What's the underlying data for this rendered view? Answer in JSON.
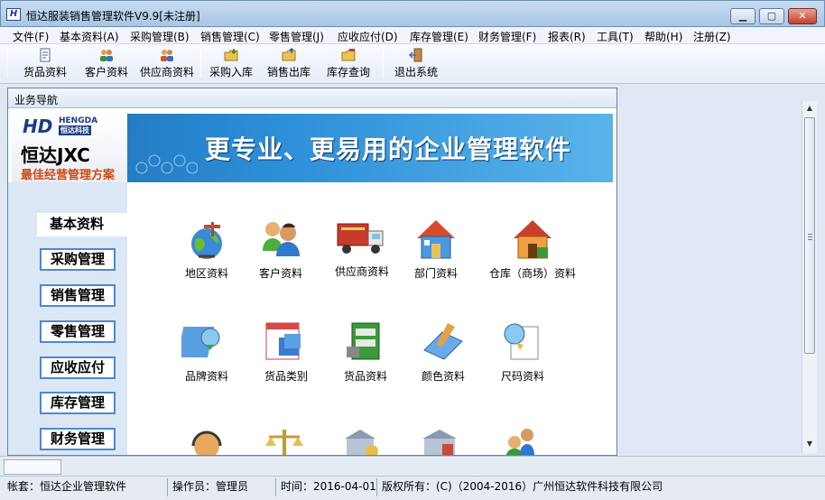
{
  "window": {
    "title": "恒达服装销售管理软件V9.9[未注册]",
    "icon_letter": "H",
    "minimize": "▁",
    "maximize": "▢",
    "close": "✕"
  },
  "menu": [
    "文件(F)",
    "基本资料(A)",
    "采购管理(B)",
    "销售管理(C)",
    "零售管理(J)",
    "应收应付(D)",
    "库存管理(E)",
    "财务管理(F)",
    "报表(R)",
    "工具(T)",
    "帮助(H)",
    "注册(Z)"
  ],
  "toolbar": {
    "items": [
      {
        "label": "货品资料",
        "icon": "document-icon"
      },
      {
        "label": "客户资料",
        "icon": "users-icon"
      },
      {
        "label": "供应商资料",
        "icon": "supplier-icon"
      },
      {
        "label": "采购入库",
        "icon": "folder-in-icon"
      },
      {
        "label": "销售出库",
        "icon": "folder-out-icon"
      },
      {
        "label": "库存查询",
        "icon": "folder-search-icon"
      },
      {
        "label": "退出系统",
        "icon": "exit-door-icon"
      }
    ]
  },
  "nav": {
    "header": "业务导航",
    "banner": {
      "logo_hd": "HD",
      "logo_hengda": "HENGDA",
      "logo_company": "恒达科技",
      "product": "恒达JXC",
      "slogan": "最佳经营管理方案",
      "headline": "更专业、更易用的企业管理软件"
    },
    "categories": [
      "基本资料",
      "采购管理",
      "销售管理",
      "零售管理",
      "应收应付",
      "库存管理",
      "财务管理"
    ],
    "active_category": "基本资料",
    "modules": [
      {
        "label": "地区资料",
        "icon": "globe-icon"
      },
      {
        "label": "客户资料",
        "icon": "customers-icon"
      },
      {
        "label": "供应商资料",
        "icon": "truck-icon"
      },
      {
        "label": "部门资料",
        "icon": "house-blue-icon"
      },
      {
        "label": "仓库（商场）资料",
        "icon": "house-orange-icon"
      },
      {
        "label": "品牌资料",
        "icon": "brand-icon"
      },
      {
        "label": "货品类别",
        "icon": "category-icon"
      },
      {
        "label": "货品资料",
        "icon": "cabinet-icon"
      },
      {
        "label": "颜色资料",
        "icon": "palette-icon"
      },
      {
        "label": "尺码资料",
        "icon": "size-icon"
      },
      {
        "label": "",
        "icon": "headset-icon"
      },
      {
        "label": "",
        "icon": "scale-icon"
      },
      {
        "label": "",
        "icon": "bank-icon"
      },
      {
        "label": "",
        "icon": "warehouse-icon"
      },
      {
        "label": "",
        "icon": "people-icon"
      }
    ]
  },
  "status": {
    "account": "帐套：恒达企业管理软件",
    "operator": "操作员：管理员",
    "time": "时间：2016-04-01",
    "copyright": "版权所有：(C)（2004-2016）广州恒达软件科技有限公司"
  },
  "colors": {
    "accent": "#4a8ad2",
    "banner_blue": "#1e6fb5",
    "slogan_orange": "#d04a10"
  }
}
